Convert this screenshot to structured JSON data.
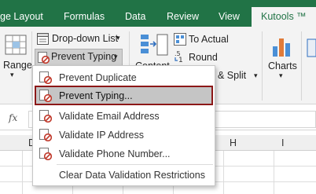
{
  "ribbon_tabs": [
    {
      "label": "ge Layout"
    },
    {
      "label": "Formulas"
    },
    {
      "label": "Data"
    },
    {
      "label": "Review"
    },
    {
      "label": "View"
    },
    {
      "label": "Kutools ™"
    }
  ],
  "ribbon": {
    "range_label": "Range",
    "dropdown_list_label": "Drop-down List",
    "prevent_typing_label": "Prevent Typing",
    "content_label": "Content",
    "to_actual_label": "To Actual",
    "round_label": "Round",
    "merge_split_label": "& Split",
    "charts_label": "Charts",
    "chevron": "▾"
  },
  "formula_bar": {
    "fx_label": "fx"
  },
  "columns": [
    "D",
    "H",
    "I"
  ],
  "menu": {
    "items": [
      {
        "label": "Prevent Duplicate",
        "icon": "prevent-duplicate-icon"
      },
      {
        "label": "Prevent Typing...",
        "icon": "prevent-typing-icon",
        "highlighted": true
      },
      {
        "label": "Validate Email Address",
        "icon": "validate-email-icon"
      },
      {
        "label": "Validate IP Address",
        "icon": "validate-ip-icon"
      },
      {
        "label": "Validate Phone Number...",
        "icon": "validate-phone-icon"
      },
      {
        "label": "Clear Data Validation Restrictions",
        "icon": "clear-validation-icon"
      }
    ]
  },
  "colors": {
    "ribbon_green": "#217346",
    "highlight_border": "#8c1818",
    "icon_red": "#c0392b"
  }
}
